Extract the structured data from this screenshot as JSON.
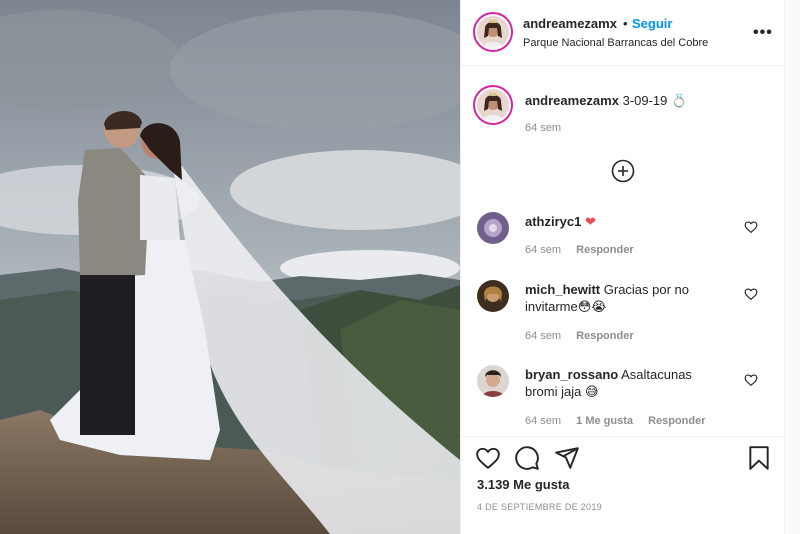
{
  "post": {
    "username": "andreamezamx",
    "separator": "•",
    "follow_label": "Seguir",
    "location": "Parque Nacional Barrancas del Cobre",
    "more_label": "•••"
  },
  "caption": {
    "username": "andreamezamx",
    "text": "3-09-19",
    "emoji": "💍",
    "age": "64 sem"
  },
  "comments": [
    {
      "username": "athziryc1",
      "text": "",
      "emoji": "❤",
      "age": "64 sem",
      "likes": "",
      "reply": "Responder"
    },
    {
      "username": "mich_hewitt",
      "text": "Gracias por no invitarme",
      "emoji": "😳😭",
      "age": "64 sem",
      "likes": "",
      "reply": "Responder"
    },
    {
      "username": "bryan_rossano",
      "text": "Asaltacunas bromi jaja",
      "emoji": "😅",
      "age": "64 sem",
      "likes": "1 Me gusta",
      "reply": "Responder"
    }
  ],
  "icons": {
    "like": "heart-icon",
    "comment": "comment-icon",
    "share": "share-icon",
    "save": "bookmark-icon",
    "load_more": "plus-circle-icon"
  },
  "footer": {
    "likes": "3.139 Me gusta",
    "date": "4 DE SEPTIEMBRE DE 2019"
  },
  "colors": {
    "accent": "#0095f6",
    "heart_red": "#ed4956"
  }
}
